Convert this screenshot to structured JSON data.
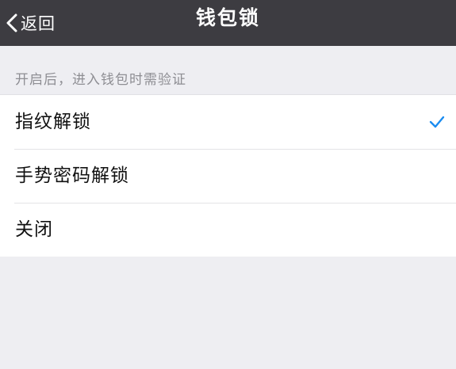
{
  "nav": {
    "back_label": "返回",
    "title": "钱包锁"
  },
  "section": {
    "header": "开启后，进入钱包时需验证"
  },
  "options": [
    {
      "label": "指纹解锁",
      "selected": true
    },
    {
      "label": "手势密码解锁",
      "selected": false
    },
    {
      "label": "关闭",
      "selected": false
    }
  ],
  "colors": {
    "nav_background": "#3d3c41",
    "page_background": "#eeeef2",
    "accent": "#1a8cf0"
  },
  "icons": {
    "back": "chevron-left-icon",
    "selected": "checkmark-icon"
  }
}
